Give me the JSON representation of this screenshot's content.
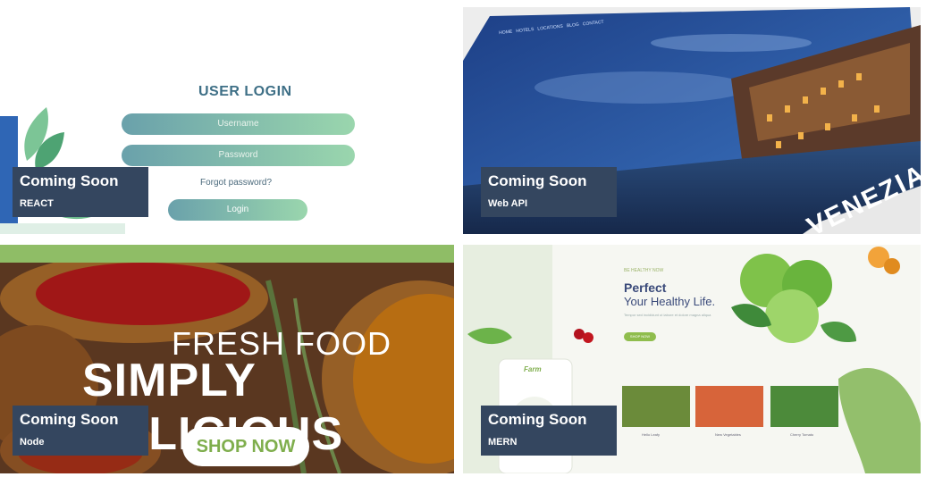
{
  "cards": [
    {
      "title": "Coming Soon",
      "subtitle": "REACT",
      "preview": {
        "heading": "USER LOGIN",
        "username_placeholder": "Username",
        "password_placeholder": "Password",
        "forgot_link": "Forgot password?",
        "login_button": "Login"
      }
    },
    {
      "title": "Coming Soon",
      "subtitle": "Web API",
      "preview": {
        "nav": [
          "HOME",
          "HOTELS",
          "LOCATIONS",
          "BLOG",
          "CONTACT"
        ],
        "city": "VENEZIA"
      }
    },
    {
      "title": "Coming Soon",
      "subtitle": "Node",
      "preview": {
        "line1": "FRESH FOOD",
        "line2": "SIMPLY DELICIOUS",
        "button": "SHOP NOW"
      }
    },
    {
      "title": "Coming Soon",
      "subtitle": "MERN",
      "preview": {
        "tag": "BE HEALTHY NOW",
        "heading_line1": "Perfect",
        "heading_line2": "Your Healthy Life.",
        "description": "Tempor sed incididunt ut labore et dolore magna aliqua",
        "button": "SHOP NOW",
        "brand": "Farm",
        "products": [
          "Hello Leafy",
          "New Vegetables",
          "Cherry Tomato"
        ]
      }
    }
  ],
  "colors": {
    "overlay_bg": "#34465f",
    "overlay_text": "#ffffff",
    "login_gradient_start": "#6aa1ab",
    "login_gradient_end": "#9ad6ad",
    "food_green": "#8fbd66",
    "organic_green": "#8fbd4d",
    "organic_navy": "#3a4a7a"
  }
}
